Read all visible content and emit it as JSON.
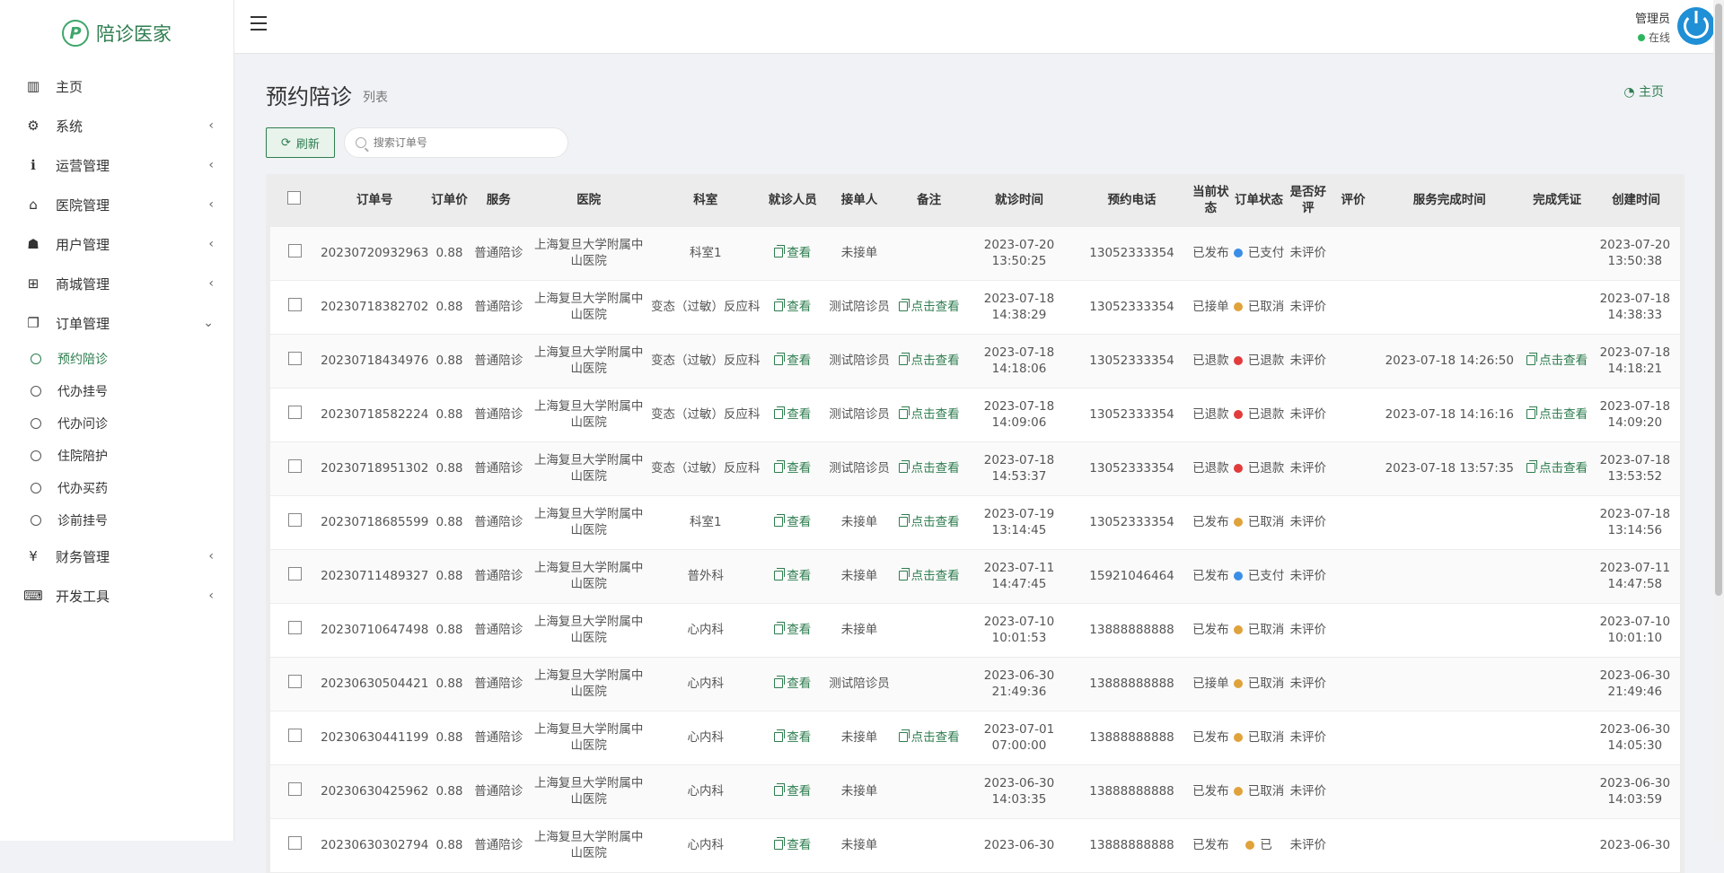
{
  "brand": {
    "name": "陪诊医家"
  },
  "menu": [
    {
      "label": "主页",
      "icon": "bar-chart-icon",
      "glyph": "▥",
      "chev": ""
    },
    {
      "label": "系统",
      "icon": "gear-icon",
      "glyph": "⚙",
      "chev": "‹"
    },
    {
      "label": "运营管理",
      "icon": "info-icon",
      "glyph": "ℹ",
      "chev": "‹"
    },
    {
      "label": "医院管理",
      "icon": "bank-icon",
      "glyph": "⌂",
      "chev": "‹"
    },
    {
      "label": "用户管理",
      "icon": "contact-icon",
      "glyph": "☗",
      "chev": "‹"
    },
    {
      "label": "商城管理",
      "icon": "cart-icon",
      "glyph": "⊞",
      "chev": "‹"
    },
    {
      "label": "订单管理",
      "icon": "copy-icon",
      "glyph": "❐",
      "chev": "⌄"
    }
  ],
  "submenu": [
    "预约陪诊",
    "代办挂号",
    "代办问诊",
    "住院陪护",
    "代办买药",
    "诊前挂号"
  ],
  "menu_bottom": [
    {
      "label": "财务管理",
      "icon": "yen-icon",
      "glyph": "¥",
      "chev": "‹"
    },
    {
      "label": "开发工具",
      "icon": "keyboard-icon",
      "glyph": "⌨",
      "chev": "‹"
    }
  ],
  "user": {
    "name": "管理员",
    "status": "在线"
  },
  "page": {
    "title": "预约陪诊",
    "subtitle": "列表",
    "crumb": "主页"
  },
  "toolbar": {
    "refresh": "刷新",
    "search_placeholder": "搜索订单号"
  },
  "colors": {
    "accent": "#2e7d4f",
    "blue": "#3b8ee6",
    "orange": "#e0a23a",
    "red": "#e23b3b"
  },
  "table": {
    "headers": [
      "订单号",
      "订单价",
      "服务",
      "医院",
      "科室",
      "就诊人员",
      "接单人",
      "备注",
      "就诊时间",
      "预约电话",
      "当前状态",
      "订单状态",
      "是否好评",
      "评价",
      "服务完成时间",
      "完成凭证",
      "创建时间"
    ],
    "view_label": "查看",
    "note_label": "点击查看",
    "proof_label": "点击查看",
    "rows": [
      {
        "id": "20230720932963",
        "price": "0.88",
        "service": "普通陪诊",
        "hospital": "上海复旦大学附属中山医院",
        "dept": "科室1",
        "acceptor": "未接单",
        "note": false,
        "visit": "2023-07-20 13:50:25",
        "phone": "13052333354",
        "state": "已发布",
        "order_status": "已支付",
        "dot": "blue",
        "review": "未评价",
        "done": "",
        "proof": false,
        "created": "2023-07-20 13:50:38"
      },
      {
        "id": "20230718382702",
        "price": "0.88",
        "service": "普通陪诊",
        "hospital": "上海复旦大学附属中山医院",
        "dept": "变态（过敏）反应科",
        "acceptor": "测试陪诊员",
        "note": true,
        "visit": "2023-07-18 14:38:29",
        "phone": "13052333354",
        "state": "已接单",
        "order_status": "已取消",
        "dot": "orange",
        "review": "未评价",
        "done": "",
        "proof": false,
        "created": "2023-07-18 14:38:33"
      },
      {
        "id": "20230718434976",
        "price": "0.88",
        "service": "普通陪诊",
        "hospital": "上海复旦大学附属中山医院",
        "dept": "变态（过敏）反应科",
        "acceptor": "测试陪诊员",
        "note": true,
        "visit": "2023-07-18 14:18:06",
        "phone": "13052333354",
        "state": "已退款",
        "order_status": "已退款",
        "dot": "red",
        "review": "未评价",
        "done": "2023-07-18 14:26:50",
        "proof": true,
        "created": "2023-07-18 14:18:21"
      },
      {
        "id": "20230718582224",
        "price": "0.88",
        "service": "普通陪诊",
        "hospital": "上海复旦大学附属中山医院",
        "dept": "变态（过敏）反应科",
        "acceptor": "测试陪诊员",
        "note": true,
        "visit": "2023-07-18 14:09:06",
        "phone": "13052333354",
        "state": "已退款",
        "order_status": "已退款",
        "dot": "red",
        "review": "未评价",
        "done": "2023-07-18 14:16:16",
        "proof": true,
        "created": "2023-07-18 14:09:20"
      },
      {
        "id": "20230718951302",
        "price": "0.88",
        "service": "普通陪诊",
        "hospital": "上海复旦大学附属中山医院",
        "dept": "变态（过敏）反应科",
        "acceptor": "测试陪诊员",
        "note": true,
        "visit": "2023-07-18 14:53:37",
        "phone": "13052333354",
        "state": "已退款",
        "order_status": "已退款",
        "dot": "red",
        "review": "未评价",
        "done": "2023-07-18 13:57:35",
        "proof": true,
        "created": "2023-07-18 13:53:52"
      },
      {
        "id": "20230718685599",
        "price": "0.88",
        "service": "普通陪诊",
        "hospital": "上海复旦大学附属中山医院",
        "dept": "科室1",
        "acceptor": "未接单",
        "note": true,
        "visit": "2023-07-19 13:14:45",
        "phone": "13052333354",
        "state": "已发布",
        "order_status": "已取消",
        "dot": "orange",
        "review": "未评价",
        "done": "",
        "proof": false,
        "created": "2023-07-18 13:14:56"
      },
      {
        "id": "20230711489327",
        "price": "0.88",
        "service": "普通陪诊",
        "hospital": "上海复旦大学附属中山医院",
        "dept": "普外科",
        "acceptor": "未接单",
        "note": true,
        "visit": "2023-07-11 14:47:45",
        "phone": "15921046464",
        "state": "已发布",
        "order_status": "已支付",
        "dot": "blue",
        "review": "未评价",
        "done": "",
        "proof": false,
        "created": "2023-07-11 14:47:58"
      },
      {
        "id": "20230710647498",
        "price": "0.88",
        "service": "普通陪诊",
        "hospital": "上海复旦大学附属中山医院",
        "dept": "心内科",
        "acceptor": "未接单",
        "note": false,
        "visit": "2023-07-10 10:01:53",
        "phone": "13888888888",
        "state": "已发布",
        "order_status": "已取消",
        "dot": "orange",
        "review": "未评价",
        "done": "",
        "proof": false,
        "created": "2023-07-10 10:01:10"
      },
      {
        "id": "20230630504421",
        "price": "0.88",
        "service": "普通陪诊",
        "hospital": "上海复旦大学附属中山医院",
        "dept": "心内科",
        "acceptor": "测试陪诊员",
        "note": false,
        "visit": "2023-06-30 21:49:36",
        "phone": "13888888888",
        "state": "已接单",
        "order_status": "已取消",
        "dot": "orange",
        "review": "未评价",
        "done": "",
        "proof": false,
        "created": "2023-06-30 21:49:46"
      },
      {
        "id": "20230630441199",
        "price": "0.88",
        "service": "普通陪诊",
        "hospital": "上海复旦大学附属中山医院",
        "dept": "心内科",
        "acceptor": "未接单",
        "note": true,
        "visit": "2023-07-01 07:00:00",
        "phone": "13888888888",
        "state": "已发布",
        "order_status": "已取消",
        "dot": "orange",
        "review": "未评价",
        "done": "",
        "proof": false,
        "created": "2023-06-30 14:05:30"
      },
      {
        "id": "20230630425962",
        "price": "0.88",
        "service": "普通陪诊",
        "hospital": "上海复旦大学附属中山医院",
        "dept": "心内科",
        "acceptor": "未接单",
        "note": false,
        "visit": "2023-06-30 14:03:35",
        "phone": "13888888888",
        "state": "已发布",
        "order_status": "已取消",
        "dot": "orange",
        "review": "未评价",
        "done": "",
        "proof": false,
        "created": "2023-06-30 14:03:59"
      },
      {
        "id": "20230630302794",
        "price": "0.88",
        "service": "普通陪诊",
        "hospital": "上海复旦大学附属中山医院",
        "dept": "心内科",
        "acceptor": "未接单",
        "note": false,
        "visit": "2023-06-30",
        "phone": "13888888888",
        "state": "已发布",
        "order_status": "已",
        "dot": "orange",
        "review": "未评价",
        "done": "",
        "proof": false,
        "created": "2023-06-30"
      }
    ]
  }
}
